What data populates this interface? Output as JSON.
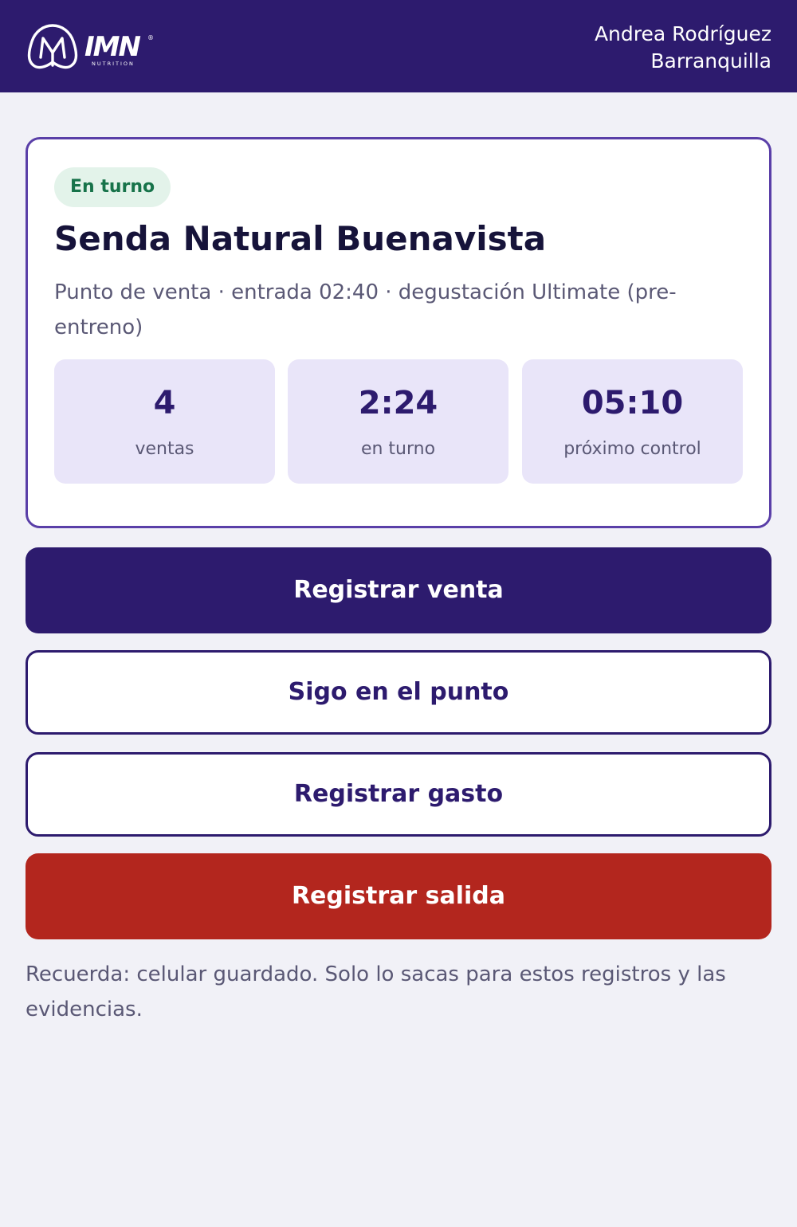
{
  "header": {
    "brand": {
      "wordmark": "IMN",
      "tagline": "NUTRITION",
      "registered": "®"
    },
    "user_name": "Andrea Rodríguez",
    "city": "Barranquilla",
    "background_color": "#2d1b6e"
  },
  "status_card": {
    "badge": "En turno",
    "title": "Senda Natural Buenavista",
    "subtitle": "Punto de venta · entrada 02:40 · degustación Ultimate (pre-entreno)",
    "stats": [
      {
        "value": "4",
        "label": "ventas"
      },
      {
        "value": "2:24",
        "label": "en turno"
      },
      {
        "value": "05:10",
        "label": "próximo control"
      }
    ]
  },
  "actions": {
    "register_sale": "Registrar venta",
    "still_here": "Sigo en el punto",
    "register_expense": "Registrar gasto",
    "register_exit": "Registrar salida"
  },
  "footnote": "Recuerda: celular guardado. Solo lo sacas para estos registros y las evidencias.",
  "colors": {
    "brand": "#2d1b6e",
    "danger": "#b3261e",
    "success": "#17734a"
  }
}
